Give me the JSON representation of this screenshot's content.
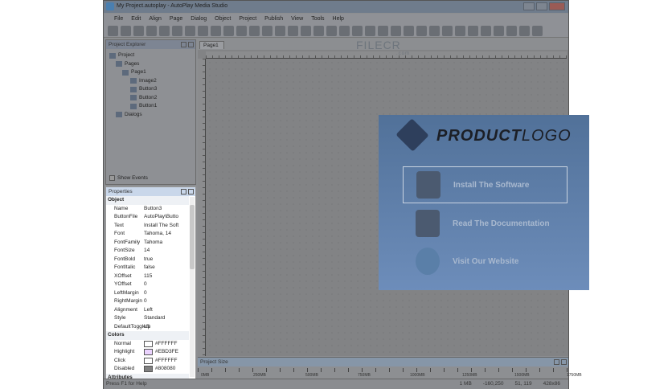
{
  "window": {
    "title": "My Project.autoplay - AutoPlay Media Studio"
  },
  "menu": [
    "File",
    "Edit",
    "Align",
    "Page",
    "Dialog",
    "Object",
    "Project",
    "Publish",
    "View",
    "Tools",
    "Help"
  ],
  "explorer": {
    "title": "Project Explorer",
    "tree": [
      "Project",
      "Pages",
      "Page1",
      "Image2",
      "Button3",
      "Button2",
      "Button1",
      "Dialogs"
    ],
    "show_events": "Show Events"
  },
  "properties": {
    "title": "Properties",
    "object_cat": "Object",
    "rows": [
      [
        "Name",
        "Button3"
      ],
      [
        "ButtonFile",
        "AutoPlay\\Butto"
      ],
      [
        "Text",
        "Install The Soft"
      ],
      [
        "Font",
        "Tahoma, 14"
      ],
      [
        "FontFamily",
        "Tahoma"
      ],
      [
        "FontSize",
        "14"
      ],
      [
        "FontBold",
        "true"
      ],
      [
        "FontItalic",
        "false"
      ],
      [
        "XOffset",
        "115"
      ],
      [
        "YOffset",
        "0"
      ],
      [
        "LeftMargin",
        "0"
      ],
      [
        "RightMargin",
        "0"
      ],
      [
        "Alignment",
        "Left"
      ],
      [
        "Style",
        "Standard"
      ],
      [
        "DefaultToggleS",
        "Up"
      ]
    ],
    "colors_cat": "Colors",
    "colors": [
      [
        "Normal",
        "#FFFFFF"
      ],
      [
        "Highlight",
        "#EBD3FE"
      ],
      [
        "Click",
        "#FFFFFF"
      ],
      [
        "Disabled",
        "#808080"
      ]
    ],
    "attributes_cat": "Attributes"
  },
  "canvas": {
    "tab": "Page1",
    "logo_a": "PRODUCT",
    "logo_b": "LOGO",
    "buttons": [
      "Install The Software",
      "Read The Documentation",
      "Visit Our Website"
    ]
  },
  "project_size": {
    "title": "Project Size",
    "ticks": [
      "0MB",
      "250MB",
      "500MB",
      "750MB",
      "1000MB",
      "1250MB",
      "1500MB",
      "1750MB"
    ]
  },
  "status": {
    "help": "Press F1 for Help",
    "size": "1 MB",
    "pos": "-160,250",
    "coords": "51, 119",
    "dims": "428x86"
  },
  "watermark": {
    "text": "FILECR",
    "sub": ".com"
  }
}
